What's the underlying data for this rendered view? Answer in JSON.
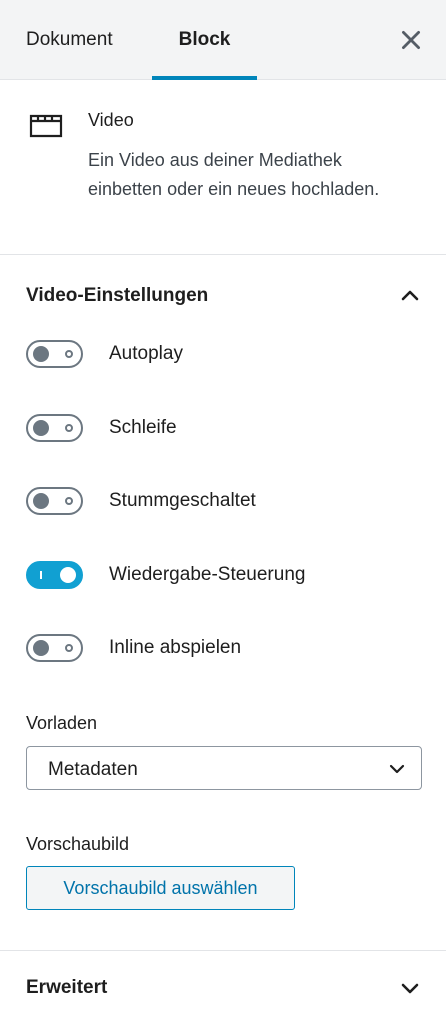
{
  "tabs": {
    "dokument": "Dokument",
    "block": "Block"
  },
  "icons": {
    "close": "close-icon",
    "block": "video-icon",
    "collapse": "chevron-up-icon",
    "expand": "chevron-down-icon"
  },
  "block": {
    "title": "Video",
    "description": "Ein Video aus deiner Mediathek einbetten oder ein neues hochladen."
  },
  "video_settings": {
    "title": "Video-Einstellungen",
    "toggles": [
      {
        "label": "Autoplay",
        "on": false
      },
      {
        "label": "Schleife",
        "on": false
      },
      {
        "label": "Stummgeschaltet",
        "on": false
      },
      {
        "label": "Wiedergabe-Steuerung",
        "on": true
      },
      {
        "label": "Inline abspielen",
        "on": false
      }
    ],
    "preload_label": "Vorladen",
    "preload_value": "Metadaten",
    "poster_label": "Vorschaubild",
    "poster_button": "Vorschaubild auswählen"
  },
  "advanced": {
    "title": "Erweitert"
  },
  "colors": {
    "accent": "#0085ba",
    "toggle_on": "#11a0d2",
    "toggle_off": "#6c7781"
  }
}
